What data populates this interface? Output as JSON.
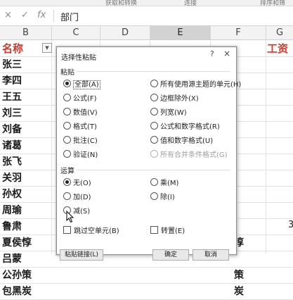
{
  "ribbon": {
    "labels": [
      "获取和转换",
      "连接",
      "排序和筛"
    ]
  },
  "formula_bar": {
    "cancel_icon": "×",
    "enter_icon": "✓",
    "fx_icon": "fx",
    "content": "部门"
  },
  "columns": {
    "headers": [
      "B",
      "C",
      "D",
      "E",
      "F",
      "G"
    ],
    "selected": "E"
  },
  "sheet": {
    "header_name": "名称",
    "names": [
      "张三",
      "李四",
      "王五",
      "刘三",
      "刘备",
      "诸葛",
      "张飞",
      "关羽",
      "孙权",
      "周瑜",
      "鲁肃",
      "夏侯惇",
      "吕蒙",
      "公孙策",
      "包黑炭"
    ],
    "header_right": "工资",
    "right_col_items": [
      {
        "row": 10,
        "text": "3"
      }
    ],
    "col_f_fragments": [
      {
        "row": 11,
        "text": "惇"
      },
      {
        "row": 13,
        "text": "策"
      },
      {
        "row": 14,
        "text": "炭"
      }
    ]
  },
  "dialog": {
    "title": "选择性粘贴",
    "help_icon": "?",
    "close_icon": "×",
    "paste_section_label": "粘贴",
    "paste_left": [
      {
        "label": "全部(A)",
        "checked": true,
        "focused": true
      },
      {
        "label": "公式(F)",
        "checked": false
      },
      {
        "label": "数值(V)",
        "checked": false
      },
      {
        "label": "格式(T)",
        "checked": false
      },
      {
        "label": "批注(C)",
        "checked": false
      },
      {
        "label": "验证(N)",
        "checked": false
      }
    ],
    "paste_right": [
      {
        "label": "所有使用源主题的单元(H)",
        "checked": false,
        "disabled": false
      },
      {
        "label": "边框除外(X)",
        "checked": false,
        "disabled": false
      },
      {
        "label": "列宽(W)",
        "checked": false,
        "disabled": false
      },
      {
        "label": "公式和数字格式(R)",
        "checked": false,
        "disabled": false
      },
      {
        "label": "值和数字格式(U)",
        "checked": false,
        "disabled": false
      },
      {
        "label": "所有合并条件格式(G)",
        "checked": false,
        "disabled": true
      }
    ],
    "operation_section_label": "运算",
    "op_left": [
      {
        "label": "无(O)",
        "checked": true
      },
      {
        "label": "加(D)",
        "checked": false
      },
      {
        "label": "减(S)",
        "checked": false
      }
    ],
    "op_right": [
      {
        "label": "乘(M)",
        "checked": false
      },
      {
        "label": "除(I)",
        "checked": false
      }
    ],
    "skip_blanks_label": "跳过空单元(B)",
    "transpose_label": "转置(E)",
    "paste_link_button": "粘贴链接(L)",
    "ok_button": "确定",
    "cancel_button": "取消"
  }
}
